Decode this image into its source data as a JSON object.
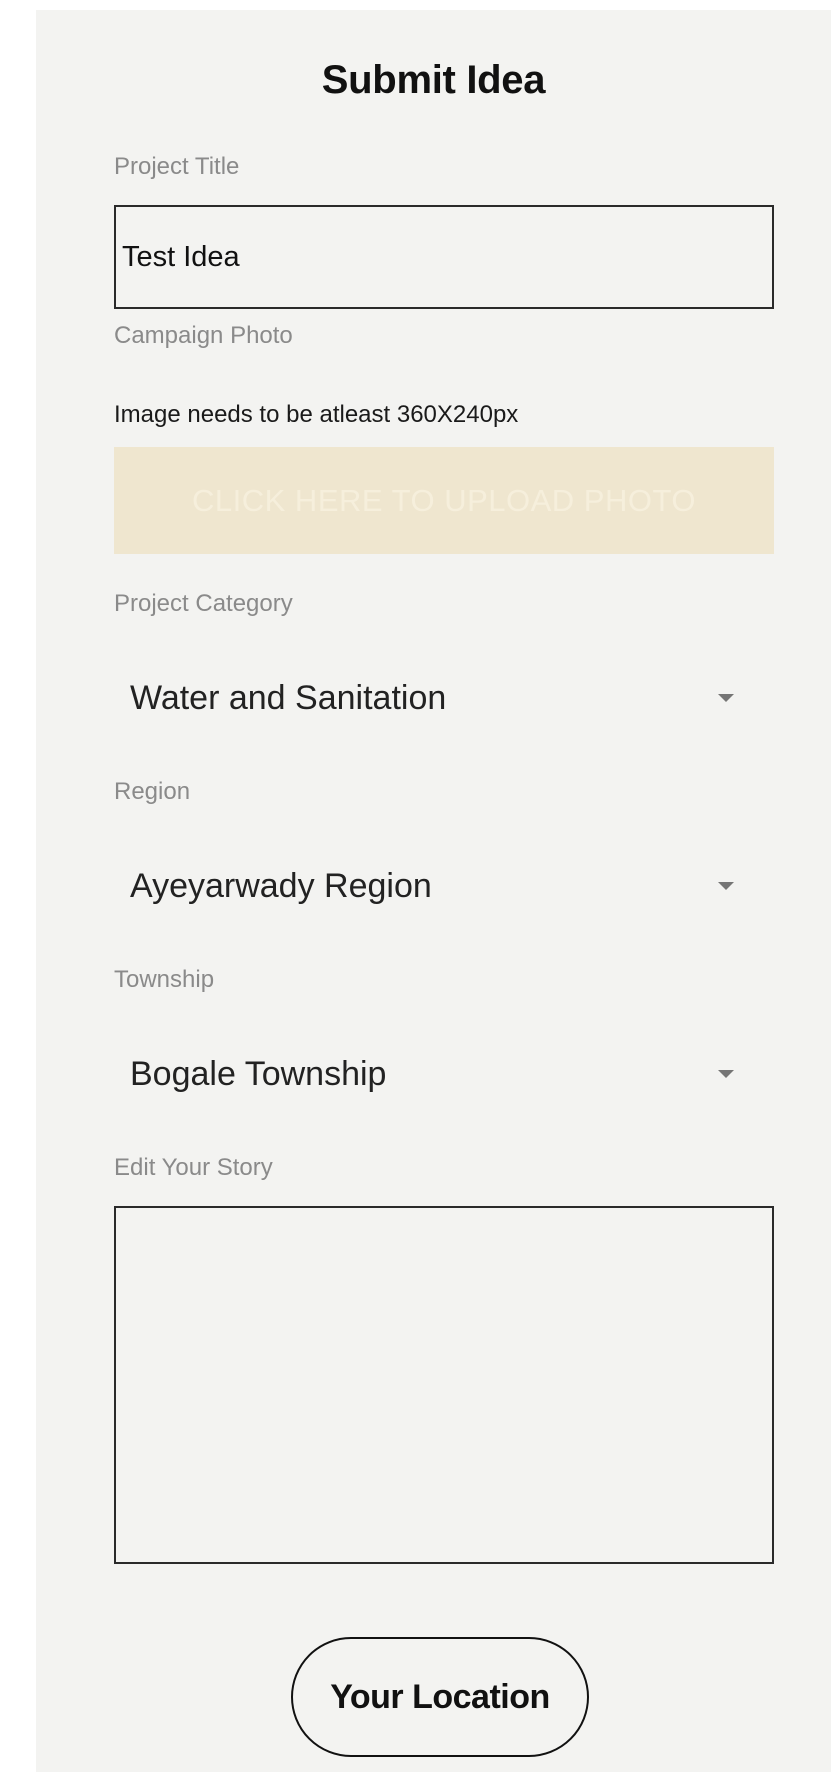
{
  "page": {
    "title": "Submit Idea"
  },
  "project_title": {
    "label": "Project Title",
    "value": "Test Idea"
  },
  "campaign_photo": {
    "label": "Campaign Photo",
    "hint": "Image needs to be atleast 360X240px",
    "upload_label": "CLICK HERE TO UPLOAD PHOTO"
  },
  "project_category": {
    "label": "Project Category",
    "selected": "Water and Sanitation"
  },
  "region": {
    "label": "Region",
    "selected": "Ayeyarwady Region"
  },
  "township": {
    "label": "Township",
    "selected": "Bogale Township"
  },
  "story": {
    "label": "Edit Your Story",
    "value": ""
  },
  "location_button": {
    "label": "Your Location"
  },
  "colors": {
    "background": "#f3f3f1",
    "upload_fill": "#efe6cf",
    "label_gray": "#8a8a8a",
    "text_dark": "#111111"
  },
  "icons": {
    "dropdown": "dropdown-caret-icon"
  }
}
